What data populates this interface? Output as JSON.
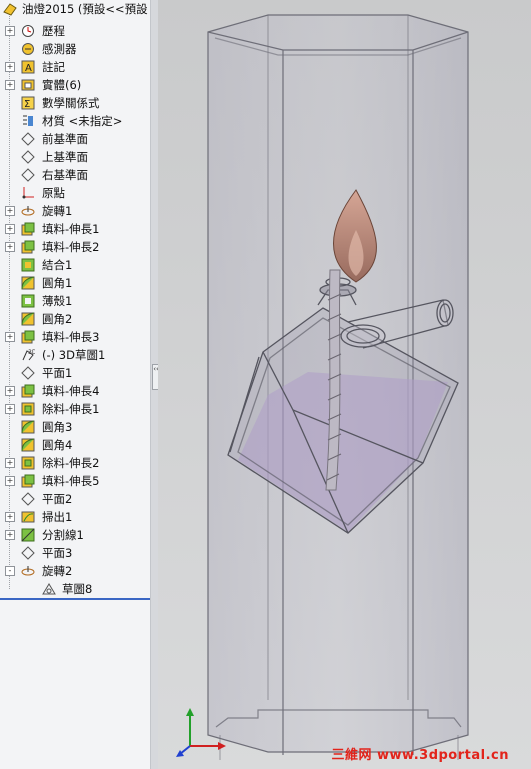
{
  "tree": {
    "root_label": "油燈2015 (預設<<預設",
    "items": [
      {
        "label": "歷程",
        "icon": "history-icon",
        "expander": "+"
      },
      {
        "label": "感測器",
        "icon": "sensor-icon",
        "expander": ""
      },
      {
        "label": "註記",
        "icon": "annotation-icon",
        "expander": "+"
      },
      {
        "label": "實體(6)",
        "icon": "solid-bodies-icon",
        "expander": "+"
      },
      {
        "label": "數學關係式",
        "icon": "equations-icon",
        "expander": ""
      },
      {
        "label": "材質 <未指定>",
        "icon": "material-icon",
        "expander": ""
      },
      {
        "label": "前基準面",
        "icon": "plane-icon",
        "expander": ""
      },
      {
        "label": "上基準面",
        "icon": "plane-icon",
        "expander": ""
      },
      {
        "label": "右基準面",
        "icon": "plane-icon",
        "expander": ""
      },
      {
        "label": "原點",
        "icon": "origin-icon",
        "expander": ""
      },
      {
        "label": "旋轉1",
        "icon": "revolve-icon",
        "expander": "+"
      },
      {
        "label": "填料-伸長1",
        "icon": "boss-extrude-icon",
        "expander": "+"
      },
      {
        "label": "填料-伸長2",
        "icon": "boss-extrude-icon",
        "expander": "+"
      },
      {
        "label": "結合1",
        "icon": "combine-icon",
        "expander": ""
      },
      {
        "label": "圓角1",
        "icon": "fillet-icon",
        "expander": ""
      },
      {
        "label": "薄殼1",
        "icon": "shell-icon",
        "expander": ""
      },
      {
        "label": "圓角2",
        "icon": "fillet-icon",
        "expander": ""
      },
      {
        "label": "填料-伸長3",
        "icon": "boss-extrude-icon",
        "expander": "+"
      },
      {
        "label": "(-) 3D草圖1",
        "icon": "3d-sketch-icon",
        "expander": ""
      },
      {
        "label": "平面1",
        "icon": "plane-icon",
        "expander": ""
      },
      {
        "label": "填料-伸長4",
        "icon": "boss-extrude-icon",
        "expander": "+"
      },
      {
        "label": "除料-伸長1",
        "icon": "cut-extrude-icon",
        "expander": "+"
      },
      {
        "label": "圓角3",
        "icon": "fillet-icon",
        "expander": ""
      },
      {
        "label": "圓角4",
        "icon": "fillet-icon",
        "expander": ""
      },
      {
        "label": "除料-伸長2",
        "icon": "cut-extrude-icon",
        "expander": "+"
      },
      {
        "label": "填料-伸長5",
        "icon": "boss-extrude-icon",
        "expander": "+"
      },
      {
        "label": "平面2",
        "icon": "plane-icon",
        "expander": ""
      },
      {
        "label": "掃出1",
        "icon": "sweep-icon",
        "expander": "+"
      },
      {
        "label": "分割線1",
        "icon": "split-line-icon",
        "expander": "+"
      },
      {
        "label": "平面3",
        "icon": "plane-icon",
        "expander": ""
      },
      {
        "label": "旋轉2",
        "icon": "revolve-icon",
        "expander": "-"
      }
    ],
    "sub_item": {
      "label": "草圖8",
      "icon": "sketch-icon"
    }
  },
  "splitter": {
    "grip_glyph": "‹‹"
  },
  "watermark": "三維网 www.3dportal.cn",
  "colors": {
    "accent": "#3a66c4",
    "flame": "#c98a7e",
    "liquid": "#b8a0d0"
  }
}
